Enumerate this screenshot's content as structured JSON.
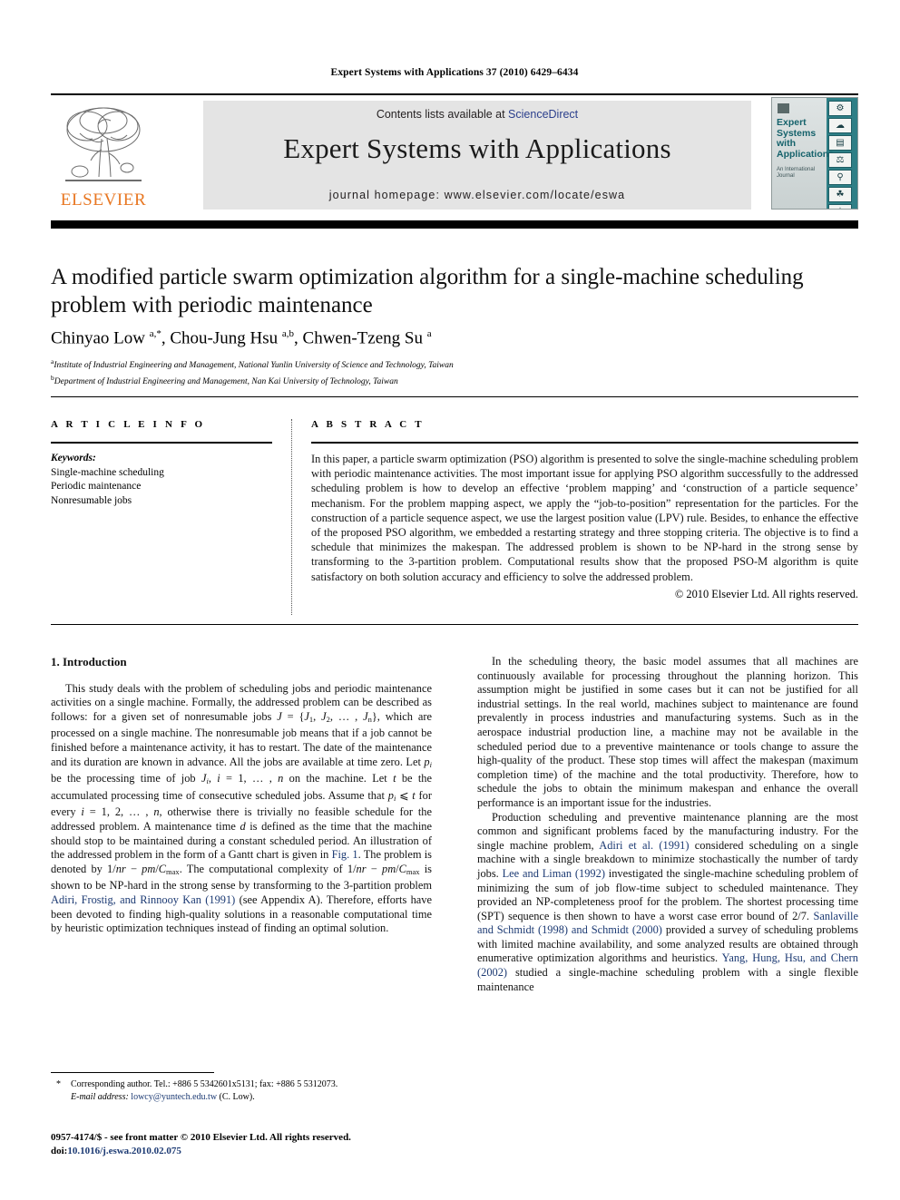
{
  "running_head": "Expert Systems with Applications 37 (2010) 6429–6434",
  "masthead": {
    "contents_prefix": "Contents lists available at ",
    "sciencedirect": "ScienceDirect",
    "journal_title": "Expert Systems with Applications",
    "homepage": "journal homepage: www.elsevier.com/locate/eswa",
    "publisher_logo_text": "ELSEVIER",
    "cover": {
      "title": "Expert Systems with Applications",
      "subtitle": "An International Journal",
      "icons": [
        "gear-icon",
        "globe-icon",
        "bar-chart-icon",
        "scales-icon",
        "microscope-icon",
        "plant-icon",
        "flask-icon",
        "caduceus-icon"
      ]
    },
    "accent_link_color": "#2b3f8c",
    "brand_orange": "#e87722",
    "band_gray": "#e4e4e4",
    "cover_teal": "#2e7f86"
  },
  "article": {
    "title": "A modified particle swarm optimization algorithm for a single-machine scheduling problem with periodic maintenance",
    "authors_html": "Chinyao Low <sup>a,*</sup>, Chou-Jung Hsu <sup>a,b</sup>, Chwen-Tzeng Su <sup>a</sup>",
    "affiliations": [
      {
        "mark": "a",
        "text": "Institute of Industrial Engineering and Management, National Yunlin University of Science and Technology, Taiwan"
      },
      {
        "mark": "b",
        "text": "Department of Industrial Engineering and Management, Nan Kai University of Technology, Taiwan"
      }
    ]
  },
  "article_info": {
    "heading": "A R T I C L E   I N F O",
    "keywords_label": "Keywords:",
    "keywords": [
      "Single-machine scheduling",
      "Periodic maintenance",
      "Nonresumable jobs"
    ]
  },
  "abstract": {
    "heading": "A B S T R A C T",
    "body": "In this paper, a particle swarm optimization (PSO) algorithm is presented to solve the single-machine scheduling problem with periodic maintenance activities. The most important issue for applying PSO algorithm successfully to the addressed scheduling problem is how to develop an effective ‘problem mapping’ and ‘construction of a particle sequence’ mechanism. For the problem mapping aspect, we apply the “job-to-position” representation for the particles. For the construction of a particle sequence aspect, we use the largest position value (LPV) rule. Besides, to enhance the effective of the proposed PSO algorithm, we embedded a restarting strategy and three stopping criteria. The objective is to find a schedule that minimizes the makespan. The addressed problem is shown to be NP-hard in the strong sense by transforming to the 3-partition problem. Computational results show that the proposed PSO-M algorithm is quite satisfactory on both solution accuracy and efficiency to solve the addressed problem.",
    "copyright": "© 2010 Elsevier Ltd. All rights reserved."
  },
  "body": {
    "section_number_title": "1. Introduction",
    "left_paragraph_1_html": "This study deals with the problem of scheduling jobs and periodic maintenance activities on a single machine. Formally, the addressed problem can be described as follows: for a given set of nonresumable jobs <span class=\"ital\">J</span> = {<span class=\"ital\">J</span><span class=\"sub\">1</span>, <span class=\"ital\">J</span><span class=\"sub\">2</span>, … , <span class=\"ital\">J</span><span class=\"sub\">n</span>}, which are processed on a single machine. The nonresumable job means that if a job cannot be finished before a maintenance activity, it has to restart. The date of the maintenance and its duration are known in advance. All the jobs are available at time zero. Let <span class=\"ital\">p<span class=\"sub\">i</span></span> be the processing time of job <span class=\"ital\">J<span class=\"sub\">i</span></span>, <span class=\"ital\">i</span> = 1, … , <span class=\"ital\">n</span> on the machine. Let <span class=\"ital\">t</span> be the accumulated processing time of consecutive scheduled jobs. Assume that <span class=\"ital\">p<span class=\"sub\">i</span></span> ⩽ <span class=\"ital\">t</span> for every <span class=\"ital\">i</span> = 1, 2, … , <span class=\"ital\">n</span>, otherwise there is trivially no feasible schedule for the addressed problem. A maintenance time <span class=\"ital\">d</span> is defined as the time that the machine should stop to be maintained during a constant scheduled period. An illustration of the addressed problem in the form of a Gantt chart is given in <span class=\"fig-ref\">Fig. 1</span>. The problem is denoted by 1/<span class=\"ital\">nr</span> − <span class=\"ital\">pm</span>/<span class=\"ital\">C</span><span class=\"sub\">max</span>. The computational complexity of 1/<span class=\"ital\">nr</span> − <span class=\"ital\">pm</span>/<span class=\"ital\">C</span><span class=\"sub\">max</span> is shown to be NP-hard in the strong sense by transforming to the 3-partition problem <span class=\"ref\">Adiri, Frostig, and Rinnooy Kan (1991)</span> (see Appendix A). Therefore, efforts have been devoted to finding high-quality solutions in a reasonable computational time by heuristic optimization techniques instead of finding an optimal solution.",
    "right_paragraph_1_html": "In the scheduling theory, the basic model assumes that all machines are continuously available for processing throughout the planning horizon. This assumption might be justified in some cases but it can not be justified for all industrial settings. In the real world, machines subject to maintenance are found prevalently in process industries and manufacturing systems. Such as in the aerospace industrial production line, a machine may not be available in the scheduled period due to a preventive maintenance or tools change to assure the high-quality of the product. These stop times will affect the makespan (maximum completion time) of the machine and the total productivity. Therefore, how to schedule the jobs to obtain the minimum makespan and enhance the overall performance is an important issue for the industries.",
    "right_paragraph_2_html": "Production scheduling and preventive maintenance planning are the most common and significant problems faced by the manufacturing industry. For the single machine problem, <span class=\"ref\">Adiri et al. (1991)</span> considered scheduling on a single machine with a single breakdown to minimize stochastically the number of tardy jobs. <span class=\"ref\">Lee and Liman (1992)</span> investigated the single-machine scheduling problem of minimizing the sum of job flow-time subject to scheduled maintenance. They provided an NP-completeness proof for the problem. The shortest processing time (SPT) sequence is then shown to have a worst case error bound of 2/7. <span class=\"ref\">Sanlaville and Schmidt (1998) and Schmidt (2000)</span> provided a survey of scheduling problems with limited machine availability, and some analyzed results are obtained through enumerative optimization algorithms and heuristics. <span class=\"ref\">Yang, Hung, Hsu, and Chern (2002)</span> studied a single-machine scheduling problem with a single flexible maintenance"
  },
  "footnote": {
    "star": "*",
    "corresponding_html": "Corresponding author. Tel.: +886 5 5342601x5131; fax: +886 5 5312073.",
    "email_label": "E-mail address:",
    "email": "lowcy@yuntech.edu.tw",
    "email_suffix": "(C. Low)."
  },
  "footer": {
    "issn_line": "0957-4174/$ - see front matter © 2010 Elsevier Ltd. All rights reserved.",
    "doi_label": "doi:",
    "doi": "10.1016/j.eswa.2010.02.075"
  }
}
